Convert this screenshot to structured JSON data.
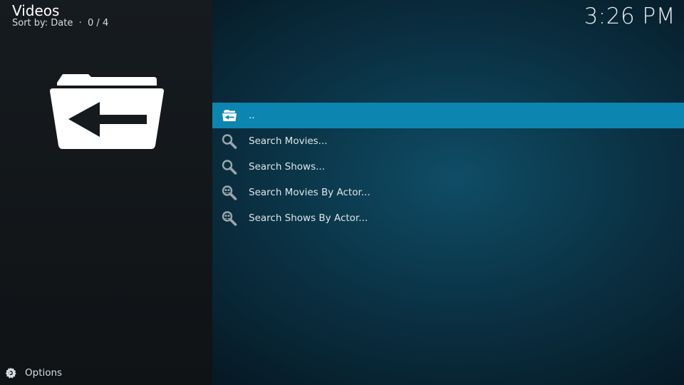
{
  "header": {
    "title": "Videos",
    "sort_info": "Sort by: Date  ·  0 / 4",
    "clock": "3:26 PM"
  },
  "thumbnail": {
    "icon": "folder-back-icon"
  },
  "list": {
    "items": [
      {
        "label": "..",
        "icon": "folder-back-icon",
        "focused": true
      },
      {
        "label": "Search Movies...",
        "icon": "search-icon",
        "focused": false
      },
      {
        "label": "Search Shows...",
        "icon": "search-icon",
        "focused": false
      },
      {
        "label": "Search Movies By Actor...",
        "icon": "search-actor-icon",
        "focused": false
      },
      {
        "label": "Search Shows By Actor...",
        "icon": "search-actor-icon",
        "focused": false
      }
    ]
  },
  "footer": {
    "options_label": "Options",
    "options_icon": "options-gear-icon"
  },
  "colors": {
    "focus": "#0c86b0",
    "left_panel": "#141a1d",
    "background": "#0b3548"
  }
}
